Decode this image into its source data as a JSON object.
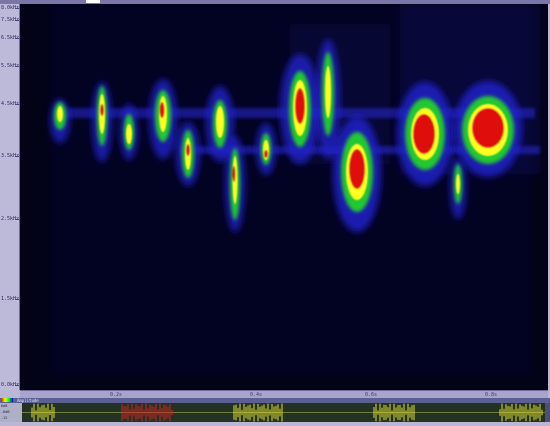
{
  "freq_axis": {
    "labels": [
      {
        "text": "8.0kHz"
      },
      {
        "text": "7.5kHz"
      },
      {
        "text": "6.5kHz"
      },
      {
        "text": "5.5kHz"
      },
      {
        "text": "4.5kHz"
      },
      {
        "text": "3.5kHz"
      },
      {
        "text": "2.5kHz"
      },
      {
        "text": "1.5kHz"
      },
      {
        "text": "0.0kHz"
      }
    ]
  },
  "time_ruler": {
    "labels": [
      "0.2s",
      "0.4s",
      "0.6s",
      "0.8s"
    ]
  },
  "waveform": {
    "header_label": "Amplitude",
    "scale_labels": [
      "6dB",
      "-6dB",
      "-12"
    ]
  },
  "colors": {
    "spectrogram_background": "#030318",
    "low_energy": "#1a1aa0",
    "mid_energy": "#2ed22e",
    "high_energy": "#ffff00",
    "peak_energy": "#e01010",
    "waveform_trace": "#dede30",
    "waveform_selected": "#d22222"
  },
  "icons": [
    "color-scale-icon"
  ]
}
